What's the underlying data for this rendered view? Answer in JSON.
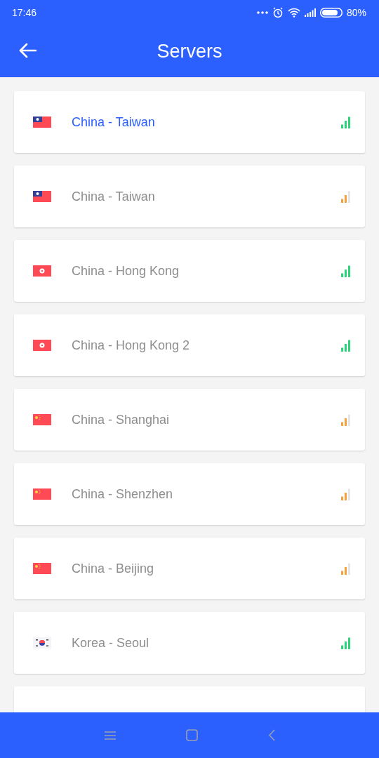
{
  "status_bar": {
    "time": "17:46",
    "battery": "80%"
  },
  "header": {
    "title": "Servers"
  },
  "servers": [
    {
      "name": "China - Taiwan",
      "kind": "tw",
      "level": 1,
      "selected": true
    },
    {
      "name": "China - Taiwan",
      "kind": "tw",
      "level": 0.67,
      "selected": false
    },
    {
      "name": "China - Hong Kong",
      "kind": "hk",
      "level": 1,
      "selected": false
    },
    {
      "name": "China - Hong Kong 2",
      "kind": "hk",
      "level": 1,
      "selected": false
    },
    {
      "name": "China - Shanghai",
      "kind": "cn",
      "level": 0.67,
      "selected": false
    },
    {
      "name": "China - Shenzhen",
      "kind": "cn",
      "level": 0.67,
      "selected": false
    },
    {
      "name": "China - Beijing",
      "kind": "cn",
      "level": 0.67,
      "selected": false
    },
    {
      "name": "Korea - Seoul",
      "kind": "kr",
      "level": 1,
      "selected": false
    }
  ]
}
